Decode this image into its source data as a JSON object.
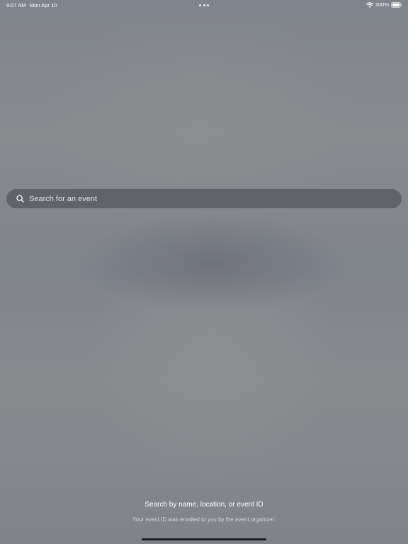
{
  "status_bar": {
    "time": "9:07 AM",
    "date": "Mon Apr 10",
    "battery": "100%",
    "icons": [
      "multitasking-dots-icon",
      "wifi-icon",
      "battery-icon"
    ]
  },
  "search": {
    "placeholder": "Search for an event",
    "value": "",
    "icon": "search-icon"
  },
  "hint": {
    "title": "Search by name, location, or event ID",
    "subtitle": "Your event ID was emailed to you by the event organizer."
  },
  "colors": {
    "background": "#84878c",
    "search_bar": "#5b5e64",
    "text_primary": "#ffffff",
    "text_secondary": "#d4d6da"
  }
}
